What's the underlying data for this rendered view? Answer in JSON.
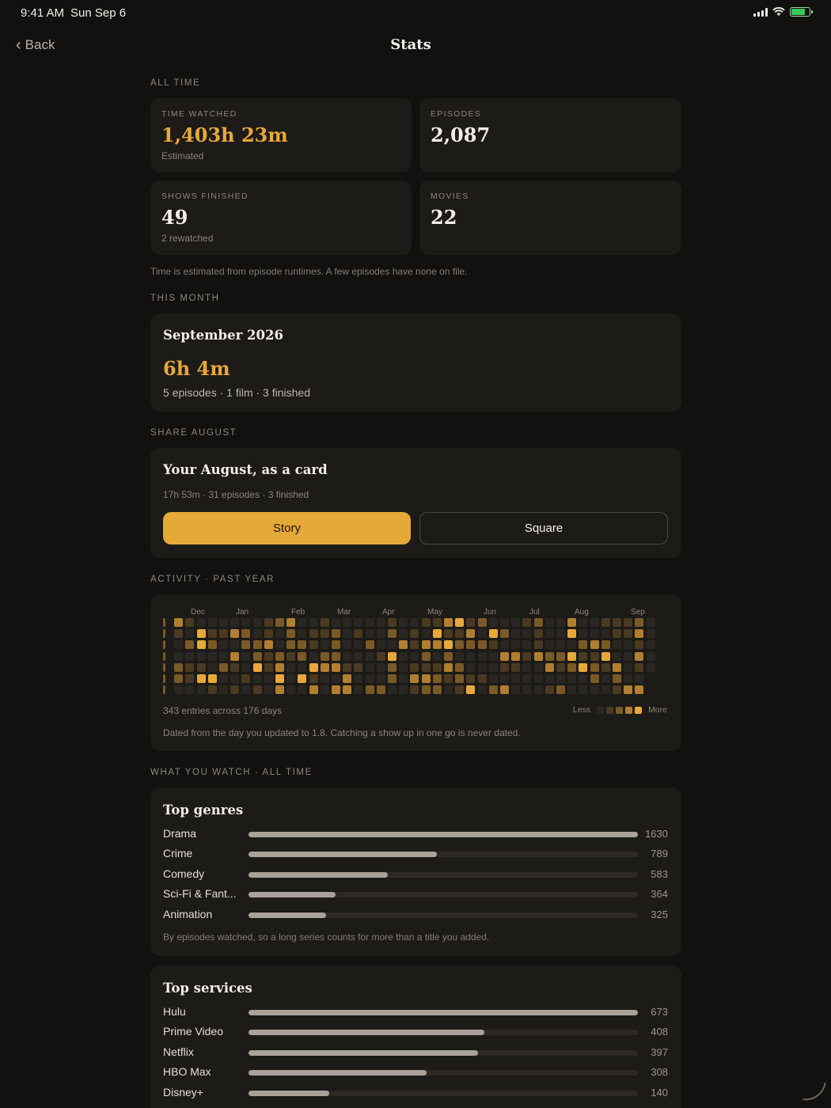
{
  "status_bar": {
    "time": "9:41 AM",
    "date": "Sun Sep 6",
    "battery_level": 0.75
  },
  "nav": {
    "back_label": "Back",
    "title": "Stats"
  },
  "all_time": {
    "section_label": "ALL TIME",
    "cards": [
      {
        "label": "TIME WATCHED",
        "value": "1,403h 23m",
        "sub": "Estimated",
        "accent": true
      },
      {
        "label": "EPISODES",
        "value": "2,087",
        "sub": "",
        "accent": false
      },
      {
        "label": "SHOWS FINISHED",
        "value": "49",
        "sub": "2 rewatched",
        "accent": false
      },
      {
        "label": "MOVIES",
        "value": "22",
        "sub": "",
        "accent": false
      }
    ],
    "note": "Time is estimated from episode runtimes. A few episodes have none on file."
  },
  "this_month": {
    "section_label": "THIS MONTH",
    "title": "September 2026",
    "value": "6h 4m",
    "sub": "5 episodes · 1 film · 3 finished"
  },
  "share": {
    "section_label": "SHARE AUGUST",
    "title": "Your August, as a card",
    "sub": "17h 53m · 31 episodes · 3 finished",
    "story_label": "Story",
    "square_label": "Square"
  },
  "activity": {
    "section_label": "ACTIVITY · PAST YEAR",
    "months": [
      "Dec",
      "Jan",
      "Feb",
      "Mar",
      "Apr",
      "May",
      "Jun",
      "Jul",
      "Aug",
      "Sep"
    ],
    "count_text": "343 entries across 176 days",
    "legend_less": "Less",
    "legend_more": "More",
    "note": "Dated from the day you updated to 1.8. Catching a show up in one go is never dated.",
    "colors": [
      "#2a2723",
      "#4a3a21",
      "#7a5a26",
      "#b17f2f",
      "#e7a83a"
    ]
  },
  "genres": {
    "section_label": "WHAT YOU WATCH · ALL TIME",
    "title": "Top genres",
    "items": [
      {
        "name": "Drama",
        "count": "1630",
        "value": 1630
      },
      {
        "name": "Crime",
        "count": "789",
        "value": 789
      },
      {
        "name": "Comedy",
        "count": "583",
        "value": 583
      },
      {
        "name": "Sci-Fi & Fant...",
        "count": "364",
        "value": 364
      },
      {
        "name": "Animation",
        "count": "325",
        "value": 325
      }
    ],
    "note": "By episodes watched, so a long series counts for more than a title you added."
  },
  "services": {
    "title": "Top services",
    "items": [
      {
        "name": "Hulu",
        "count": "673",
        "value": 673
      },
      {
        "name": "Prime Video",
        "count": "408",
        "value": 408
      },
      {
        "name": "Netflix",
        "count": "397",
        "value": 397
      },
      {
        "name": "HBO Max",
        "count": "308",
        "value": 308
      },
      {
        "name": "Disney+",
        "count": "140",
        "value": 140
      }
    ]
  }
}
